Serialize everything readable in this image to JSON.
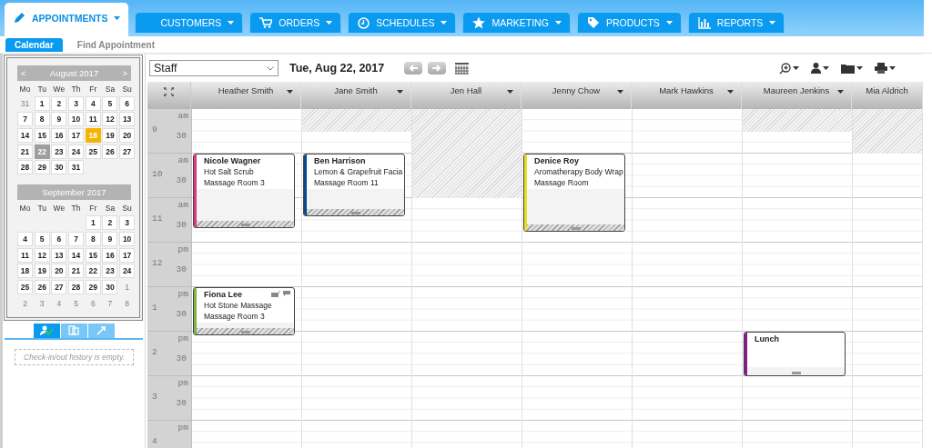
{
  "nav": {
    "tabs": [
      {
        "label": "APPOINTMENTS",
        "selected": true
      },
      {
        "label": "CUSTOMERS",
        "selected": false
      },
      {
        "label": "ORDERS",
        "selected": false
      },
      {
        "label": "SCHEDULES",
        "selected": false
      },
      {
        "label": "MARKETING",
        "selected": false
      },
      {
        "label": "PRODUCTS",
        "selected": false
      },
      {
        "label": "REPORTS",
        "selected": false
      }
    ]
  },
  "subtabs": [
    {
      "label": "Calendar",
      "selected": true
    },
    {
      "label": "Find Appointment",
      "selected": false
    }
  ],
  "sidebar": {
    "months": [
      {
        "title": "August 2017",
        "prev": "<",
        "next": ">",
        "weekdays": [
          "Mo",
          "Tu",
          "We",
          "Th",
          "Fr",
          "Sa",
          "Su"
        ],
        "weeks": [
          [
            {
              "day": "31",
              "kind": "other"
            },
            {
              "day": "1",
              "kind": "day"
            },
            {
              "day": "2",
              "kind": "day"
            },
            {
              "day": "3",
              "kind": "day"
            },
            {
              "day": "4",
              "kind": "day"
            },
            {
              "day": "5",
              "kind": "day"
            },
            {
              "day": "6",
              "kind": "day"
            }
          ],
          [
            {
              "day": "7",
              "kind": "day"
            },
            {
              "day": "8",
              "kind": "day"
            },
            {
              "day": "9",
              "kind": "day"
            },
            {
              "day": "10",
              "kind": "day"
            },
            {
              "day": "11",
              "kind": "day"
            },
            {
              "day": "12",
              "kind": "day"
            },
            {
              "day": "13",
              "kind": "day"
            }
          ],
          [
            {
              "day": "14",
              "kind": "day"
            },
            {
              "day": "15",
              "kind": "day"
            },
            {
              "day": "16",
              "kind": "day"
            },
            {
              "day": "17",
              "kind": "day"
            },
            {
              "day": "18",
              "kind": "today"
            },
            {
              "day": "19",
              "kind": "day"
            },
            {
              "day": "20",
              "kind": "day"
            }
          ],
          [
            {
              "day": "21",
              "kind": "day"
            },
            {
              "day": "22",
              "kind": "selected"
            },
            {
              "day": "23",
              "kind": "day"
            },
            {
              "day": "24",
              "kind": "day"
            },
            {
              "day": "25",
              "kind": "day"
            },
            {
              "day": "26",
              "kind": "day"
            },
            {
              "day": "27",
              "kind": "day"
            }
          ],
          [
            {
              "day": "28",
              "kind": "day"
            },
            {
              "day": "29",
              "kind": "day"
            },
            {
              "day": "30",
              "kind": "day"
            },
            {
              "day": "31",
              "kind": "day"
            },
            {
              "kind": "blank"
            },
            {
              "kind": "blank"
            },
            {
              "kind": "blank"
            }
          ]
        ]
      },
      {
        "title": "September 2017",
        "weekdays": [
          "Mo",
          "Tu",
          "We",
          "Th",
          "Fr",
          "Sa",
          "Su"
        ],
        "weeks": [
          [
            {
              "kind": "blank"
            },
            {
              "kind": "blank"
            },
            {
              "kind": "blank"
            },
            {
              "kind": "blank"
            },
            {
              "day": "1",
              "kind": "day"
            },
            {
              "day": "2",
              "kind": "day"
            },
            {
              "day": "3",
              "kind": "day"
            }
          ],
          [
            {
              "day": "4",
              "kind": "day"
            },
            {
              "day": "5",
              "kind": "day"
            },
            {
              "day": "6",
              "kind": "day"
            },
            {
              "day": "7",
              "kind": "day"
            },
            {
              "day": "8",
              "kind": "day"
            },
            {
              "day": "9",
              "kind": "day"
            },
            {
              "day": "10",
              "kind": "day"
            }
          ],
          [
            {
              "day": "11",
              "kind": "day"
            },
            {
              "day": "12",
              "kind": "day"
            },
            {
              "day": "13",
              "kind": "day"
            },
            {
              "day": "14",
              "kind": "day"
            },
            {
              "day": "15",
              "kind": "day"
            },
            {
              "day": "16",
              "kind": "day"
            },
            {
              "day": "17",
              "kind": "day"
            }
          ],
          [
            {
              "day": "18",
              "kind": "day"
            },
            {
              "day": "19",
              "kind": "day"
            },
            {
              "day": "20",
              "kind": "day"
            },
            {
              "day": "21",
              "kind": "day"
            },
            {
              "day": "22",
              "kind": "day"
            },
            {
              "day": "23",
              "kind": "day"
            },
            {
              "day": "24",
              "kind": "day"
            }
          ],
          [
            {
              "day": "25",
              "kind": "day"
            },
            {
              "day": "26",
              "kind": "day"
            },
            {
              "day": "27",
              "kind": "day"
            },
            {
              "day": "28",
              "kind": "day"
            },
            {
              "day": "29",
              "kind": "day"
            },
            {
              "day": "30",
              "kind": "day"
            },
            {
              "day": "1",
              "kind": "other"
            }
          ],
          [
            {
              "day": "2",
              "kind": "other"
            },
            {
              "day": "3",
              "kind": "other"
            },
            {
              "day": "4",
              "kind": "other"
            },
            {
              "day": "5",
              "kind": "other"
            },
            {
              "day": "6",
              "kind": "other"
            },
            {
              "day": "7",
              "kind": "other"
            },
            {
              "day": "8",
              "kind": "other"
            }
          ]
        ]
      }
    ],
    "tool_tabs": [
      {
        "selected": true
      },
      {
        "selected": false
      },
      {
        "selected": false
      }
    ],
    "history_note": "Check-in/out history is empty."
  },
  "scheduler": {
    "view": "Staff",
    "date": "Tue, Aug 22, 2017",
    "hours": [
      {
        "hour": "9",
        "period": "am",
        "half": "30"
      },
      {
        "hour": "10",
        "period": "am",
        "half": "30"
      },
      {
        "hour": "11",
        "period": "am",
        "half": "30"
      },
      {
        "hour": "12",
        "period": "pm",
        "half": "30"
      },
      {
        "hour": "1",
        "period": "pm",
        "half": "30"
      },
      {
        "hour": "2",
        "period": "pm",
        "half": "30"
      },
      {
        "hour": "3",
        "period": "pm",
        "half": "30"
      },
      {
        "hour": "4",
        "period": "pm"
      }
    ],
    "staff": [
      {
        "name": "Heather Smith",
        "dropdown": true,
        "appointments": [
          {
            "kind": "appointment",
            "client": "Nicole Wagner",
            "service": "Hot Salt Scrub",
            "room": "Massage Room 3",
            "color": "#e0358a",
            "badges": false
          },
          {
            "kind": "appointment",
            "client": "Fiona Lee",
            "service": "Hot Stone Massage",
            "room": "Massage Room 3",
            "color": "#7ab648",
            "badges": true
          }
        ]
      },
      {
        "name": "Jane Smith",
        "dropdown": true,
        "appointments": [
          {
            "kind": "appointment",
            "client": "Ben Harrison",
            "service": "Lemon & Grapefruit Facia",
            "room": "Massage Room 11",
            "color": "#0b4a8a",
            "badges": false
          }
        ]
      },
      {
        "name": "Jen Hall",
        "dropdown": true
      },
      {
        "name": "Jenny Chow",
        "dropdown": true,
        "appointments": [
          {
            "kind": "appointment",
            "client": "Denice Roy",
            "service": "Aromatherapy Body Wrap",
            "room": "Massage Room",
            "color": "#e8e020",
            "badges": false
          }
        ]
      },
      {
        "name": "Mark Hawkins",
        "dropdown": true
      },
      {
        "name": "Maureen Jenkins",
        "dropdown": true,
        "appointments": [
          {
            "kind": "block",
            "client": "Lunch",
            "color": "#8a1a8a",
            "badges": false
          }
        ]
      },
      {
        "name": "Mia Aldrich",
        "dropdown": false
      }
    ]
  }
}
